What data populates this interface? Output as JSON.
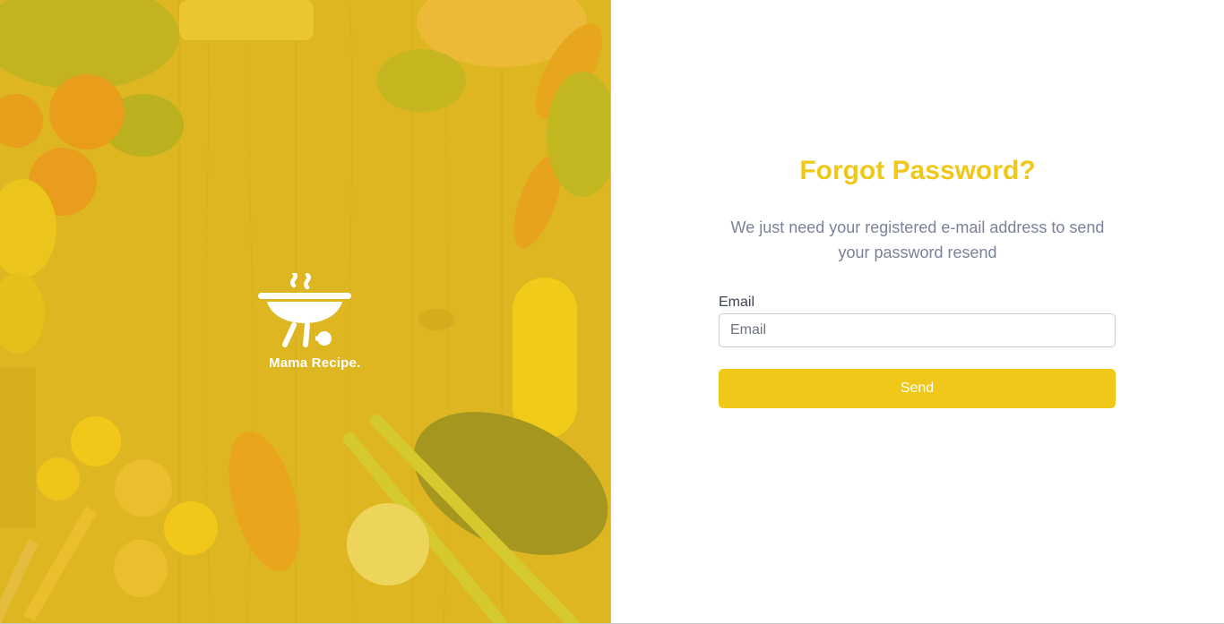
{
  "brand": {
    "name": "Mama Recipe.",
    "logo_icon": "grill-icon"
  },
  "hero": {
    "background": "food-ingredients-photo",
    "tint_color": "#efc81a"
  },
  "form": {
    "title": "Forgot Password?",
    "subtitle": "We just need your registered e-mail address to send your password resend",
    "email_label": "Email",
    "email_placeholder": "Email",
    "email_value": "",
    "send_label": "Send"
  },
  "colors": {
    "accent": "#efc81a",
    "subtitle_text": "#7b8299",
    "label_text": "#3e4450"
  }
}
